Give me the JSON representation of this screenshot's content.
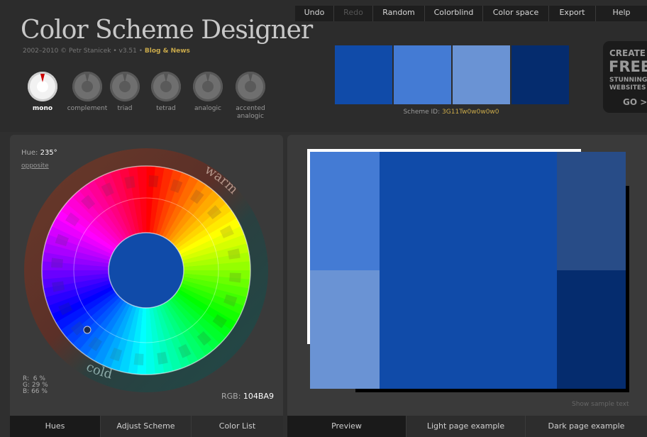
{
  "app": {
    "title": "Color Scheme Designer",
    "credit_prefix": "2002–2010 ©",
    "author": "Petr Stanicek",
    "version": "• v3.51 •",
    "blog_link": "Blog & News"
  },
  "menu": [
    {
      "label": "Undo",
      "enabled": true
    },
    {
      "label": "Redo",
      "enabled": false
    },
    {
      "label": "Random",
      "enabled": true
    },
    {
      "label": "Colorblind",
      "enabled": true
    },
    {
      "label": "Color space",
      "enabled": true
    },
    {
      "label": "Export",
      "enabled": true
    },
    {
      "label": "Help",
      "enabled": true
    }
  ],
  "scheme_types": [
    {
      "label": "mono",
      "active": true
    },
    {
      "label": "complement",
      "active": false
    },
    {
      "label": "triad",
      "active": false
    },
    {
      "label": "tetrad",
      "active": false
    },
    {
      "label": "analogic",
      "active": false
    },
    {
      "label": "accented analogic",
      "active": false
    }
  ],
  "palette": {
    "swatches": [
      "#104BA9",
      "#447BD4",
      "#6A93D4",
      "#052C6E"
    ],
    "scheme_id_label": "Scheme ID:",
    "scheme_id": "3G11Tw0w0w0w0"
  },
  "ad": {
    "line1": "CREATE",
    "line2": "FREE",
    "line3": "STUNNING",
    "line4": "WEBSITES",
    "line5": "GO >>"
  },
  "hue_panel": {
    "hue_label": "Hue:",
    "hue_value": "235°",
    "opposite_link": "opposite",
    "warm_label": "warm",
    "cold_label": "cold",
    "rgb_r": "R:  6 %",
    "rgb_g": "G: 29 %",
    "rgb_b": "B: 66 %",
    "rgb_hex_label": "RGB:",
    "rgb_hex": "104BA9",
    "center_color": "#104BA9"
  },
  "left_tabs": [
    {
      "label": "Hues",
      "active": true
    },
    {
      "label": "Adjust Scheme",
      "active": false
    },
    {
      "label": "Color List",
      "active": false
    }
  ],
  "preview_panel": {
    "show_sample_text": "Show sample text",
    "colors": {
      "primary": "#104BA9",
      "light1": "#447BD4",
      "light2": "#6A93D4",
      "dark1": "#284C87",
      "dark2": "#052C6E"
    }
  },
  "right_tabs": [
    {
      "label": "Preview",
      "active": true
    },
    {
      "label": "Light page example",
      "active": false
    },
    {
      "label": "Dark page example",
      "active": false
    }
  ]
}
